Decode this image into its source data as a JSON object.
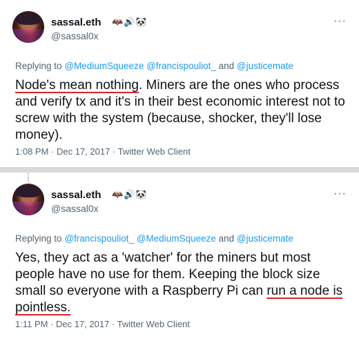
{
  "tweets": [
    {
      "display_name": "sassal.eth",
      "name_icons": "🦇🔊🐼",
      "handle": "@sassal0x",
      "more": "···",
      "replying_label": "Replying to",
      "mentions": [
        "@MediumSqueeze",
        "@francispouliot_"
      ],
      "and_label": "and",
      "last_mention": "@justicemate",
      "text_underlined": "Node's mean nothing",
      "text_rest": ". Miners are the ones who process and verify tx and it's in their best economic interest not to screw with the system (because, shocker, they'll lose money).",
      "timestamp": "1:08 PM · Dec 17, 2017 · Twitter Web Client",
      "highlight_color": "#d6232a"
    },
    {
      "display_name": "sassal.eth",
      "name_icons": "🦇🔊🐼",
      "handle": "@sassal0x",
      "more": "···",
      "replying_label": "Replying to",
      "mentions": [
        "@francispouliot_",
        "@MediumSqueeze"
      ],
      "and_label": "and",
      "last_mention": "@justicemate",
      "text_before": "Yes, they act as a 'watcher' for the miners but most people have no use for them. Keeping the block size small so everyone with a Raspberry Pi can ",
      "text_underlined": "run a node is pointless.",
      "timestamp": "1:11 PM · Dec 17, 2017 · Twitter Web Client",
      "highlight_color": "#d6232a"
    }
  ],
  "colors": {
    "link": "#1d9bf0",
    "muted": "#536471",
    "text": "#0f1419"
  }
}
